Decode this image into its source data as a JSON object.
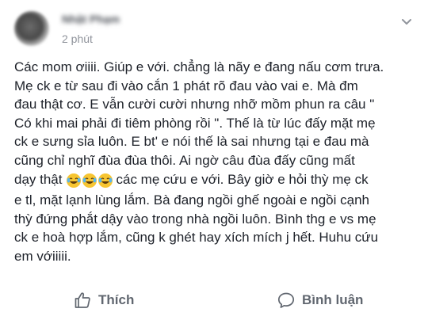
{
  "post": {
    "author_name": "Nhật Phạm",
    "timestamp": "2 phút",
    "body_lines": [
      "Các mom ơiiii. Giúp e với. chẳng là nãy e đang nấu cơm trưa.",
      "Mẹ ck e từ sau đi vào cắn 1 phát rõ đau vào vai e. Mà đm",
      "đau thật cơ. E vẫn cười cười nhưng nhỡ mồm phun ra câu \"",
      "Có khi mai phải đi tiêm phòng rồi \". Thế là từ lúc đấy mặt mẹ",
      "ck e sưng sỉa luôn. E bt' e nói thế là sai nhưng tại e đau mà",
      "cũng chỉ nghĩ đùa đùa thôi. Ai ngờ câu đùa đấy cũng mất",
      "dạy thật",
      "các mẹ cứu e với. Bây giờ e hỏi thỳ mẹ ck",
      "e tl, mặt lạnh lùng lắm. Bà đang ngồi ghế ngoài e ngồi cạnh",
      "thỳ đứng phắt dậy vào trong nhà ngồi luôn. Bình thg e vs mẹ",
      "ck e hoà hợp lắm, cũng k ghét hay xích mích j hết. Huhu cứu",
      "em vớiiiii."
    ],
    "emoji": [
      "laughing-tears-emoji",
      "laughing-tears-emoji",
      "laughing-tears-emoji"
    ]
  },
  "actions": {
    "like_label": "Thích",
    "comment_label": "Bình luận"
  },
  "colors": {
    "text": "#1d2129",
    "secondary_text": "#90949c",
    "action_text": "#616770"
  }
}
